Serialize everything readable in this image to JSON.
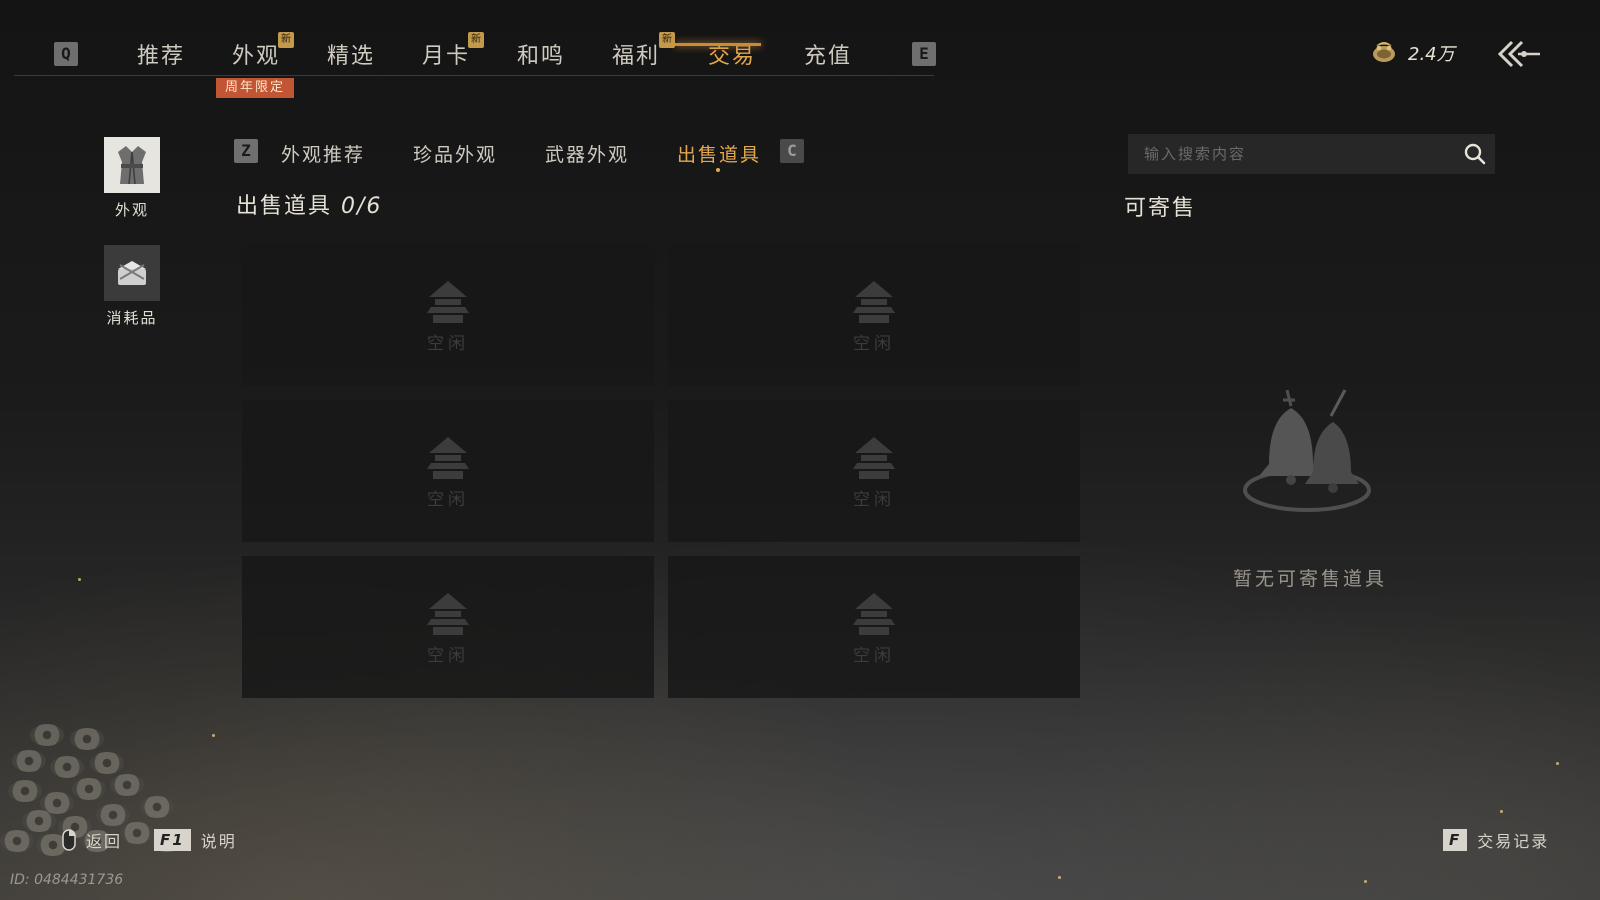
{
  "top_nav": {
    "left_key": "Q",
    "right_key": "E",
    "tabs": [
      {
        "label": "推荐"
      },
      {
        "label": "外观",
        "badge": "新"
      },
      {
        "label": "精选"
      },
      {
        "label": "月卡",
        "badge": "新"
      },
      {
        "label": "和鸣"
      },
      {
        "label": "福利",
        "badge": "新"
      },
      {
        "label": "交易",
        "active": true
      },
      {
        "label": "充值"
      }
    ],
    "limited_badge": "周年限定"
  },
  "currency": {
    "amount": "2.4万",
    "icon": "coin-pouch-icon"
  },
  "side_categories": [
    {
      "label": "外观",
      "icon": "outfit-icon"
    },
    {
      "label": "消耗品",
      "icon": "consumable-icon"
    }
  ],
  "sub_tabs": {
    "left_key": "Z",
    "right_key": "C",
    "items": [
      {
        "label": "外观推荐"
      },
      {
        "label": "珍品外观"
      },
      {
        "label": "武器外观"
      },
      {
        "label": "出售道具",
        "active": true
      }
    ]
  },
  "sell_section": {
    "title": "出售道具",
    "count": "0/6",
    "slots": [
      "空闲",
      "空闲",
      "空闲",
      "空闲",
      "空闲",
      "空闲"
    ]
  },
  "consign": {
    "title": "可寄售",
    "search_placeholder": "输入搜索内容",
    "empty_text": "暂无可寄售道具",
    "empty_icon": "bells-icon"
  },
  "bottom": {
    "back_label": "返回",
    "help_key": "F1",
    "help_label": "说明",
    "record_key": "F",
    "record_label": "交易记录",
    "uid": "ID: 0484431736"
  },
  "colors": {
    "accent": "#e3a84d",
    "limited_badge": "#c25534",
    "new_badge": "#c39a4a"
  }
}
